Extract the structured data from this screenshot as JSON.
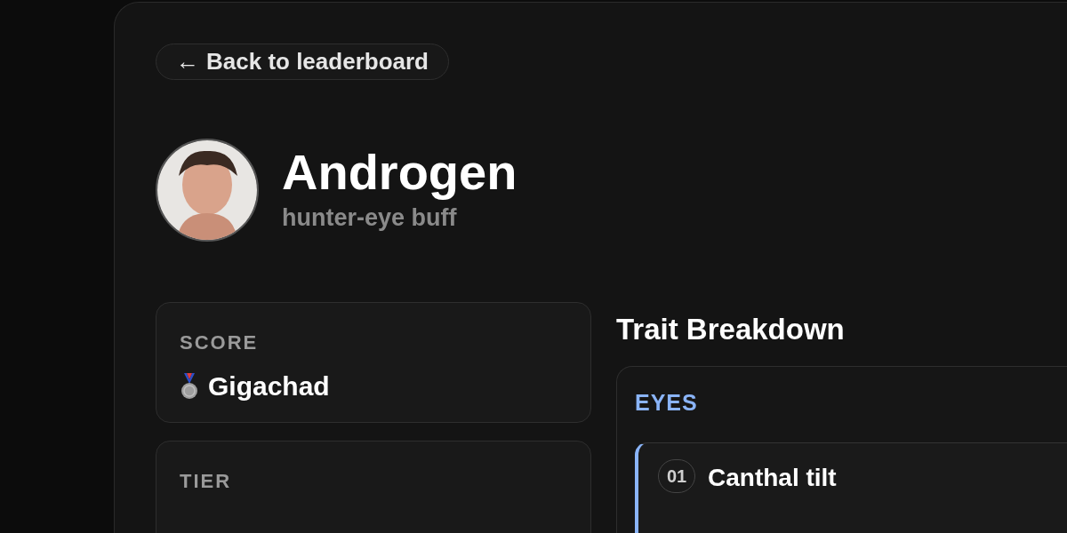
{
  "back_button": {
    "icon": "←",
    "label": "Back to leaderboard"
  },
  "profile": {
    "name": "Androgen",
    "subtitle": "hunter-eye buff"
  },
  "stats": [
    {
      "label": "SCORE",
      "value": "Gigachad",
      "medal": true
    },
    {
      "label": "TIER"
    }
  ],
  "traits": {
    "title": "Trait Breakdown",
    "groups": [
      {
        "label": "EYES",
        "color": "#8ab4f8",
        "items": [
          {
            "number": "01",
            "name": "Canthal tilt"
          }
        ]
      }
    ]
  }
}
